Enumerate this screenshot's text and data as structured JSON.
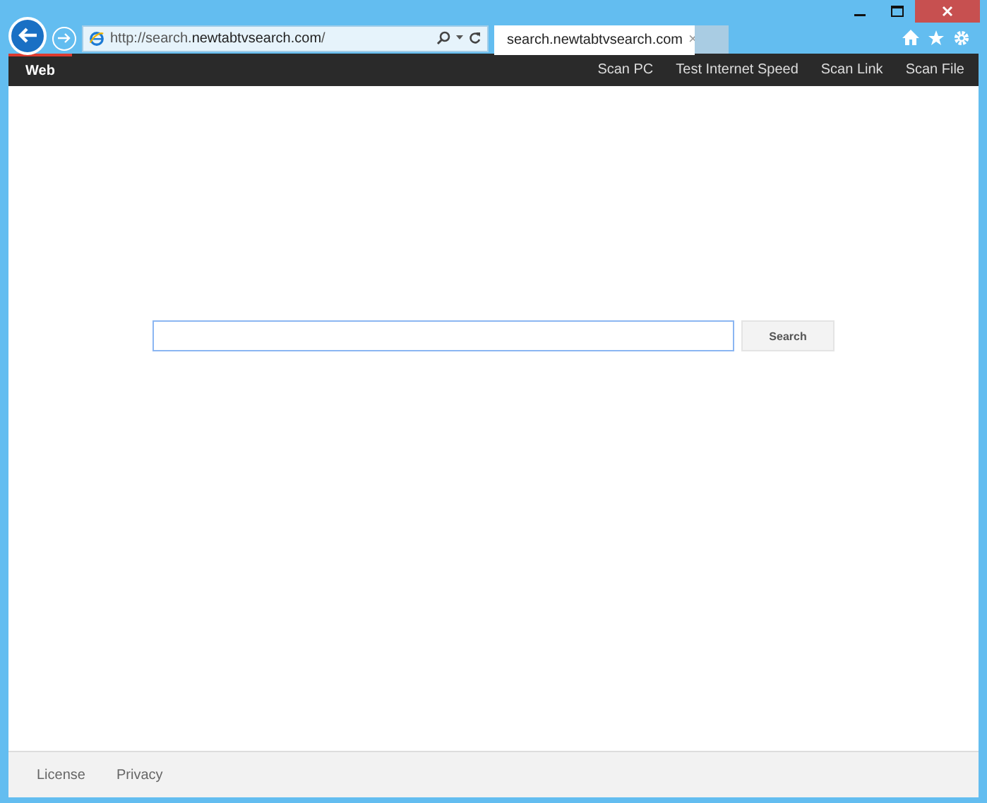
{
  "browser": {
    "address": "http://search.**newtabtvsearch.com**/",
    "tab": {
      "title": "search.newtabtvsearch.com",
      "close": "×"
    }
  },
  "nav": {
    "brand": {
      "label": "Web",
      "selected": true
    },
    "links": [
      "Scan PC",
      "Test Internet Speed",
      "Scan Link",
      "Scan File"
    ]
  },
  "search": {
    "button": "Search"
  },
  "footer": [
    "License",
    "Privacy"
  ]
}
